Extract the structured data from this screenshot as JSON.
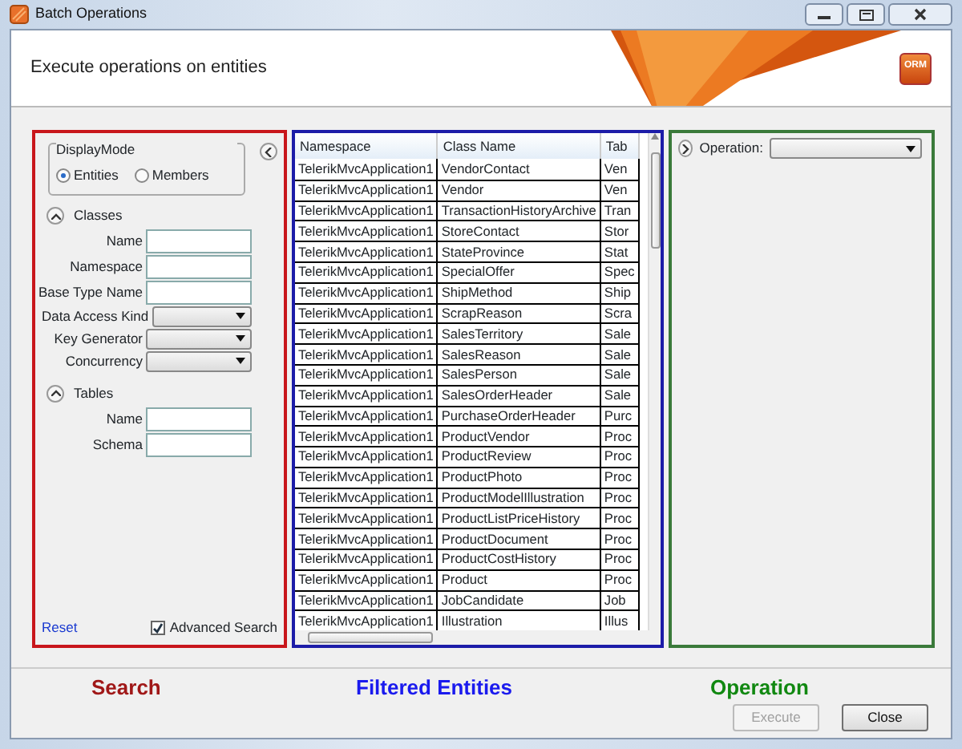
{
  "window": {
    "title": "Batch Operations"
  },
  "header": {
    "title": "Execute operations on entities",
    "logo": "ORM"
  },
  "search": {
    "display_mode": {
      "label": "DisplayMode",
      "options": [
        {
          "label": "Entities",
          "selected": true
        },
        {
          "label": "Members",
          "selected": false
        }
      ]
    },
    "sections": [
      {
        "title": "Classes",
        "expanded": true,
        "fields": [
          {
            "label": "Name",
            "kind": "text"
          },
          {
            "label": "Namespace",
            "kind": "text"
          },
          {
            "label": "Base Type Name",
            "kind": "text"
          },
          {
            "label": "Data Access Kind",
            "kind": "select"
          },
          {
            "label": "Key Generator",
            "kind": "select"
          },
          {
            "label": "Concurrency",
            "kind": "select"
          }
        ]
      },
      {
        "title": "Tables",
        "expanded": true,
        "fields": [
          {
            "label": "Name",
            "kind": "text"
          },
          {
            "label": "Schema",
            "kind": "text"
          }
        ]
      }
    ],
    "reset": "Reset",
    "advanced_search": {
      "label": "Advanced Search",
      "checked": true
    }
  },
  "grid": {
    "columns": [
      "Namespace",
      "Class Name",
      "Tab"
    ],
    "rows": [
      [
        "TelerikMvcApplication1",
        "VendorContact",
        "Ven"
      ],
      [
        "TelerikMvcApplication1",
        "Vendor",
        "Ven"
      ],
      [
        "TelerikMvcApplication1",
        "TransactionHistoryArchive",
        "Tran"
      ],
      [
        "TelerikMvcApplication1",
        "StoreContact",
        "Stor"
      ],
      [
        "TelerikMvcApplication1",
        "StateProvince",
        "Stat"
      ],
      [
        "TelerikMvcApplication1",
        "SpecialOffer",
        "Spec"
      ],
      [
        "TelerikMvcApplication1",
        "ShipMethod",
        "Ship"
      ],
      [
        "TelerikMvcApplication1",
        "ScrapReason",
        "Scra"
      ],
      [
        "TelerikMvcApplication1",
        "SalesTerritory",
        "Sale"
      ],
      [
        "TelerikMvcApplication1",
        "SalesReason",
        "Sale"
      ],
      [
        "TelerikMvcApplication1",
        "SalesPerson",
        "Sale"
      ],
      [
        "TelerikMvcApplication1",
        "SalesOrderHeader",
        "Sale"
      ],
      [
        "TelerikMvcApplication1",
        "PurchaseOrderHeader",
        "Purc"
      ],
      [
        "TelerikMvcApplication1",
        "ProductVendor",
        "Proc"
      ],
      [
        "TelerikMvcApplication1",
        "ProductReview",
        "Proc"
      ],
      [
        "TelerikMvcApplication1",
        "ProductPhoto",
        "Proc"
      ],
      [
        "TelerikMvcApplication1",
        "ProductModelIllustration",
        "Proc"
      ],
      [
        "TelerikMvcApplication1",
        "ProductListPriceHistory",
        "Proc"
      ],
      [
        "TelerikMvcApplication1",
        "ProductDocument",
        "Proc"
      ],
      [
        "TelerikMvcApplication1",
        "ProductCostHistory",
        "Proc"
      ],
      [
        "TelerikMvcApplication1",
        "Product",
        "Proc"
      ],
      [
        "TelerikMvcApplication1",
        "JobCandidate",
        "Job"
      ],
      [
        "TelerikMvcApplication1",
        "Illustration",
        "Illus"
      ]
    ]
  },
  "operation": {
    "label": "Operation:"
  },
  "legend": [
    {
      "text": "Search",
      "color": "#a01818"
    },
    {
      "text": "Filtered Entities",
      "color": "#1a1aee"
    },
    {
      "text": "Operation",
      "color": "#118811"
    }
  ],
  "buttons": [
    {
      "label": "Execute",
      "disabled": true
    },
    {
      "label": "Close",
      "disabled": false
    }
  ]
}
